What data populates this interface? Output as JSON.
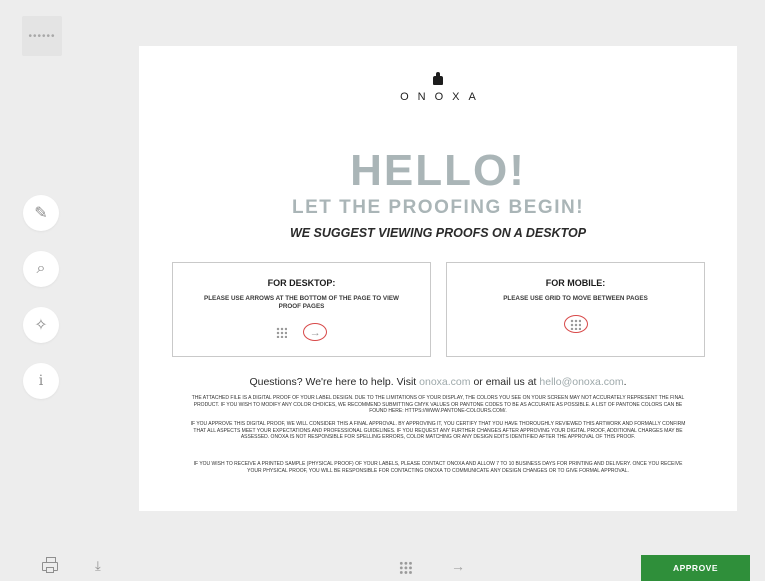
{
  "sidebar": {
    "menu_dots": "••••••",
    "tools": [
      {
        "icon": "pencil-icon",
        "glyph": "✎"
      },
      {
        "icon": "zoom-icon",
        "glyph": "⌕"
      },
      {
        "icon": "magic-wand-icon",
        "glyph": "✧"
      },
      {
        "icon": "info-icon",
        "glyph": "i"
      }
    ]
  },
  "proof": {
    "brand": "ONOXA",
    "headline": "HELLO!",
    "subtitle": "LET THE PROOFING BEGIN!",
    "suggestion": "WE SUGGEST VIEWING PROOFS ON A DESKTOP",
    "desktop_box": {
      "title": "FOR DESKTOP:",
      "text": "PLEASE USE ARROWS AT THE BOTTOM OF THE PAGE TO VIEW PROOF PAGES"
    },
    "mobile_box": {
      "title": "FOR MOBILE:",
      "text": "PLEASE USE GRID TO MOVE BETWEEN PAGES"
    },
    "questions": {
      "prefix": "Questions? We're here to help. Visit ",
      "site": "onoxa.com",
      "middle": " or email us at ",
      "email": "hello@onoxa.com",
      "suffix": "."
    },
    "fine_print": [
      "The attached file is a digital proof of your label design. Due to the limitations of your display, the colors you see on your screen may not accurately represent the final product. If you wish to modify any color choices, we recommend submitting CMYK values or Pantone codes to be as accurate as possible. A list of Pantone colors can be found here: https://www.pantone-colours.com/.",
      "If you approve this digital proof, we will consider this a final approval. By approving it, you certify that you have thoroughly reviewed this artwork and formally confirm that all aspects meet your expectations and professional guidelines. If you request any further changes after approving your digital proof, additional charges may be assessed. Onoxa is not responsible for spelling errors, color matching or any design edits identified after the approval of this proof.",
      "If you wish to receive a printed sample (physical proof) of your labels, please contact Onoxa and allow 7 to 10 business days for printing and delivery. Once you receive your physical proof, you will be responsible for contacting Onoxa to communicate any design changes or to give formal approval."
    ]
  },
  "bottom_bar": {
    "print_icon": "printer-icon",
    "download_icon": "download-icon",
    "download_glyph": "⤓",
    "grid_icon": "grid-icon",
    "next_icon": "arrow-right-icon",
    "next_glyph": "→",
    "approve_label": "APPROVE",
    "approve_color": "#2f8f3a"
  }
}
